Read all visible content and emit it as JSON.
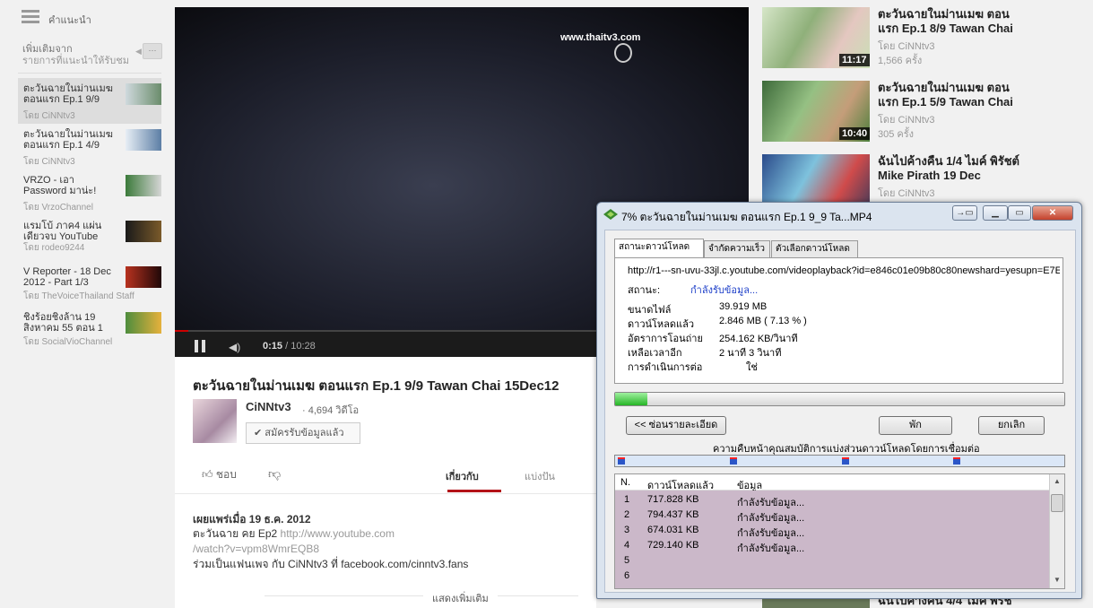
{
  "guide": {
    "title": "คำแนะนำ",
    "from_title": "เพิ่มเติมจาก",
    "from_sub": "รายการที่แนะนำให้รับชม",
    "more_button": "···",
    "items": [
      {
        "title": "ตะวันฉายในม่านเมฆ ตอนแรก Ep.1 9/9",
        "by": "โดย CiNNtv3"
      },
      {
        "title": "ตะวันฉายในม่านเมฆ ตอนแรก Ep.1 4/9",
        "by": "โดย CiNNtv3"
      },
      {
        "title": "VRZO - เอา Password มาน่ะ!",
        "by": "โดย VrzoChannel"
      },
      {
        "title": "แรมโบ้ ภาค4 แผ่นเดียวจบ YouTube",
        "by": "โดย rodeo9244"
      },
      {
        "title": "V Reporter - 18 Dec 2012 - Part 1/3",
        "by": "โดย TheVoiceThailand Staff"
      },
      {
        "title": "ชิงร้อยชิงล้าน 19 สิงหาคม 55 ตอน 1",
        "by": "โดย SocialVioChannel"
      }
    ]
  },
  "player": {
    "watermark": "www.thaitv3.com",
    "time_current": "0:15",
    "time_total": "/ 10:28",
    "progress": 0.024
  },
  "video": {
    "title": "ตะวันฉายในม่านเมฆ ตอนแรก Ep.1 9/9 Tawan Chai 15Dec12",
    "channel": "CiNNtv3",
    "views": "· 4,694 วิดีโอ",
    "subscribe": "✔ สมัครรับข้อมูลแล้ว",
    "like_label": "ชอบ",
    "tab_about": "เกี่ยวกับ",
    "tab_share": "แบ่งปัน",
    "published": "เผยแพร่เมื่อ 19 ธ.ค. 2012",
    "desc1": "ตะวันฉาย คย Ep2 ",
    "desc_link1": "http://www.youtube.com",
    "desc_link2": "/watch?v=vpm8WmrEQB8",
    "desc3": "ร่วมเป็นแฟนเพจ กับ CiNNtv3 ที่ facebook.com/cinntv3.fans",
    "show_more": "แสดงเพิ่มเติม"
  },
  "related": [
    {
      "title": "ตะวันฉายในม่านเมฆ ตอนแรก Ep.1 8/9 Tawan Chai",
      "by": "โดย CiNNtv3",
      "views": "1,566 ครั้ง",
      "duration": "11:17"
    },
    {
      "title": "ตะวันฉายในม่านเมฆ ตอนแรก Ep.1 5/9 Tawan Chai",
      "by": "โดย CiNNtv3",
      "views": "305 ครั้ง",
      "duration": "10:40"
    },
    {
      "title": "ฉันไปค้างคืน 1/4 ไมค์ พิรัชต์ Mike Pirath 19 Dec",
      "by": "โดย CiNNtv3",
      "views": "",
      "duration": ""
    },
    {
      "title": "ฉันไปค้างคืน 4/4 ไมค์ พิรัช",
      "by": "",
      "views": "",
      "duration": ""
    }
  ],
  "idm": {
    "title": "7% ตะวันฉายในม่านเมฆ ตอนแรก Ep.1 9_9 Ta...MP4",
    "btn_min": "▁",
    "btn_max": "▭",
    "btn_close": "✕",
    "tabs": [
      "สถานะดาวน์โหลด",
      "จำกัดความเร็ว",
      "ตัวเลือกดาวน์โหลด"
    ],
    "url": "http://r1---sn-uvu-33jl.c.youtube.com/videoplayback?id=e846c01e09b80c80newshard=yesupn=E7E",
    "status_label": "สถานะ:",
    "status_value": "กำลังรับข้อมูล...",
    "file_size_label": "ขนาดไฟล์",
    "file_size": "39.919  MB",
    "downloaded_label": "ดาวน์โหลดแล้ว",
    "downloaded": "2.846  MB  ( 7.13 % )",
    "rate_label": "อัตราการโอนถ่าย",
    "rate": "254.162  KB/วินาที",
    "remaining_label": "เหลือเวลาอีก",
    "remaining": "2 นาที 3 วินาที",
    "resume_label": "การดำเนินการต่อ",
    "resume": "ใช่",
    "progress": 0.0713,
    "btn_hide": "<< ซ่อนรายละเอียด",
    "btn_pause": "พัก",
    "btn_cancel": "ยกเลิก",
    "conn_label": "ความคืบหน้าคุณสมบัติการแบ่งส่วนดาวน์โหลดโดยการเชื่อมต่อ",
    "col_n": "N.",
    "col_downloaded": "ดาวน์โหลดแล้ว",
    "col_info": "ข้อมูล",
    "rows": [
      {
        "n": "1",
        "size": "717.828  KB",
        "info": "กำลังรับข้อมูล..."
      },
      {
        "n": "2",
        "size": "794.437  KB",
        "info": "กำลังรับข้อมูล..."
      },
      {
        "n": "3",
        "size": "674.031  KB",
        "info": "กำลังรับข้อมูล..."
      },
      {
        "n": "4",
        "size": "729.140  KB",
        "info": "กำลังรับข้อมูล..."
      },
      {
        "n": "5",
        "size": "",
        "info": ""
      },
      {
        "n": "6",
        "size": "",
        "info": ""
      }
    ]
  }
}
